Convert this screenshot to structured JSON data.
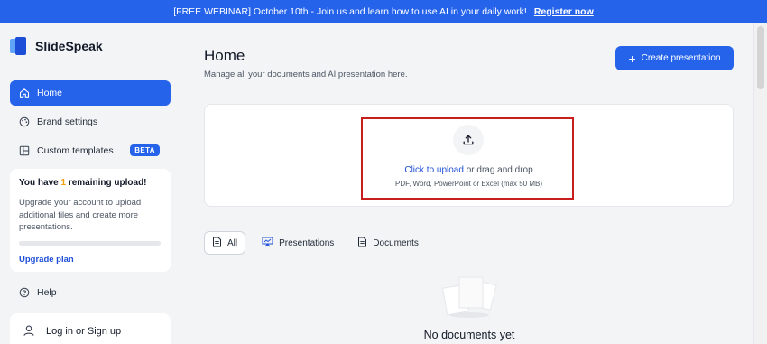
{
  "banner": {
    "text": "[FREE WEBINAR] October 10th - Join us and learn how to use AI in your daily work!",
    "link": "Register now"
  },
  "brand": {
    "name": "SlideSpeak",
    "icon": "slidespeak-logo"
  },
  "sidebar": {
    "items": [
      {
        "label": "Home",
        "icon": "home-icon",
        "active": true
      },
      {
        "label": "Brand settings",
        "icon": "palette-icon"
      },
      {
        "label": "Custom templates",
        "icon": "template-icon",
        "badge": "BETA"
      }
    ],
    "upload_card": {
      "title_pre": "You have ",
      "count": "1",
      "title_post": " remaining upload!",
      "description": "Upgrade your account to upload additional files and create more presentations.",
      "link": "Upgrade plan"
    },
    "help": {
      "label": "Help",
      "icon": "help-icon"
    },
    "login": {
      "label": "Log in or Sign up",
      "icon": "user-icon"
    }
  },
  "main": {
    "title": "Home",
    "subtitle": "Manage all your documents and AI presentation here.",
    "create_button": "Create presentation",
    "dropzone": {
      "click_text": "Click to upload",
      "rest_text": " or drag and drop",
      "hint": "PDF, Word, PowerPoint or Excel (max 50 MB)"
    },
    "tabs": [
      {
        "label": "All",
        "icon": "document-icon",
        "active": true
      },
      {
        "label": "Presentations",
        "icon": "presentation-icon"
      },
      {
        "label": "Documents",
        "icon": "document-icon"
      }
    ],
    "empty_text": "No documents yet"
  },
  "colors": {
    "accent": "#2563eb",
    "highlight": "#c81e1e",
    "warning": "#f59e0b"
  }
}
